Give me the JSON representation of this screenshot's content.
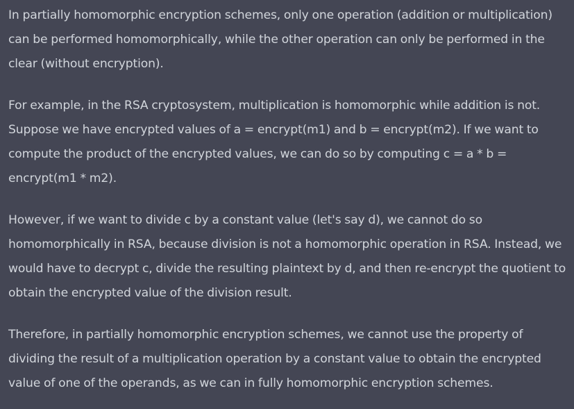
{
  "message": {
    "paragraphs": [
      "In partially homomorphic encryption schemes, only one operation (addition or multiplication) can be performed homomorphically, while the other operation can only be performed in the clear (without encryption).",
      "For example, in the RSA cryptosystem, multiplication is homomorphic while addition is not. Suppose we have encrypted values of a = encrypt(m1) and b = encrypt(m2). If we want to compute the product of the encrypted values, we can do so by computing c = a * b = encrypt(m1 * m2).",
      "However, if we want to divide c by a constant value (let's say d), we cannot do so homomorphically in RSA, because division is not a homomorphic operation in RSA. Instead, we would have to decrypt c, divide the resulting plaintext by d, and then re-encrypt the quotient to obtain the encrypted value of the division result.",
      "Therefore, in partially homomorphic encryption schemes, we cannot use the property of dividing the result of a multiplication operation by a constant value to obtain the encrypted value of one of the operands, as we can in fully homomorphic encryption schemes."
    ]
  },
  "colors": {
    "background": "#444654",
    "text": "#d1d5db"
  }
}
